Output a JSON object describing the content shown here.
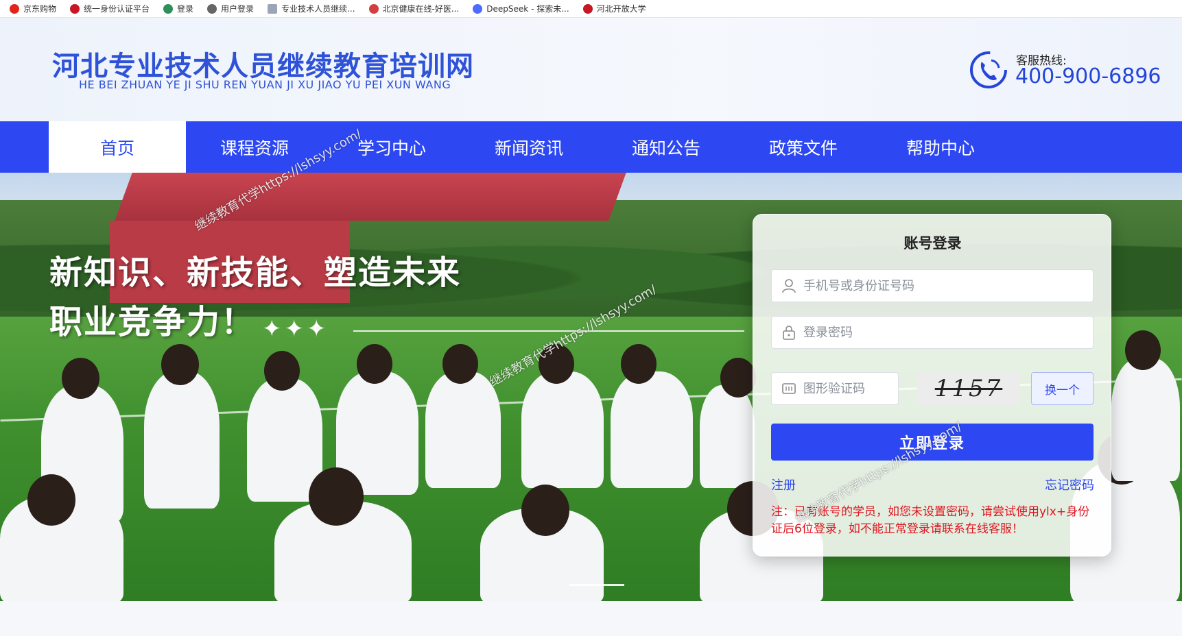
{
  "bookmarks": [
    {
      "label": "京东购物",
      "color": "#e1251b"
    },
    {
      "label": "统一身份认证平台",
      "color": "#c81623"
    },
    {
      "label": "登录",
      "color": "#2f8f5a"
    },
    {
      "label": "用户登录",
      "color": "#666666"
    },
    {
      "label": "专业技术人员继续...",
      "color": "#9aa6b8"
    },
    {
      "label": "北京健康在线-好医...",
      "color": "#d23f3f"
    },
    {
      "label": "DeepSeek - 探索未...",
      "color": "#4d6bfe"
    },
    {
      "label": "河北开放大学",
      "color": "#c81623"
    }
  ],
  "header": {
    "title": "河北专业技术人员继续教育培训网",
    "subtitle": "HE BEI ZHUAN YE JI SHU REN YUAN JI XU JIAO YU PEI XUN WANG",
    "hotline_label": "客服热线:",
    "hotline_number": "400-900-6896"
  },
  "nav": {
    "items": [
      "首页",
      "课程资源",
      "学习中心",
      "新闻资讯",
      "通知公告",
      "政策文件",
      "帮助中心"
    ],
    "active_index": 0
  },
  "banner": {
    "slogan_line1": "新知识、新技能、塑造未来",
    "slogan_line2": "职业竞争力！",
    "sparkles": "✦✦✦"
  },
  "login": {
    "title": "账号登录",
    "username_placeholder": "手机号或身份证号码",
    "password_placeholder": "登录密码",
    "captcha_placeholder": "图形验证码",
    "captcha_text": "1157",
    "swap_label": "换一个",
    "submit_label": "立即登录",
    "register_label": "注册",
    "forgot_label": "忘记密码",
    "notice": "注：已有账号的学员，如您未设置密码，请尝试使用ylx+身份证后6位登录，如不能正常登录请联系在线客服！"
  },
  "watermark": "继续教育代学https://lshsyy.com/",
  "colors": {
    "brand": "#2d48f2",
    "title_blue": "#2e52d8",
    "notice_red": "#e0141e"
  }
}
